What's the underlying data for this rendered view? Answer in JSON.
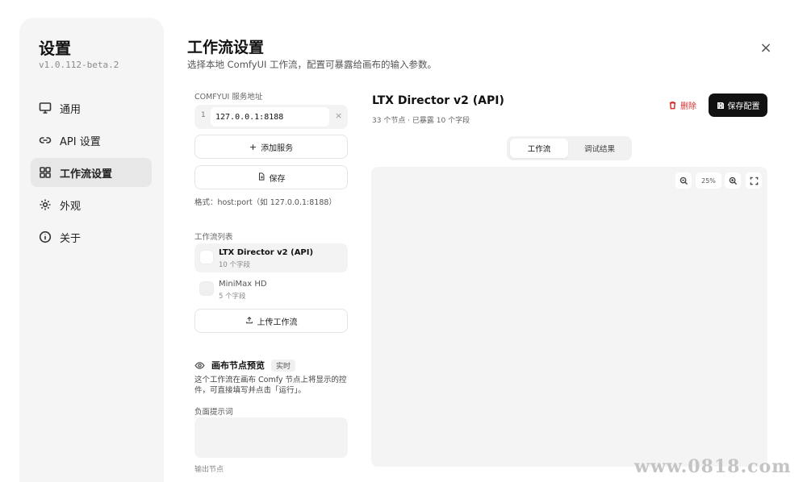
{
  "sidebar": {
    "title": "设置",
    "version": "v1.0.112-beta.2",
    "items": [
      {
        "label": "通用",
        "icon": "monitor-icon"
      },
      {
        "label": "API 设置",
        "icon": "link-icon"
      },
      {
        "label": "工作流设置",
        "icon": "grid-icon",
        "active": true
      },
      {
        "label": "外观",
        "icon": "gear-icon"
      },
      {
        "label": "关于",
        "icon": "info-icon"
      }
    ]
  },
  "header": {
    "title": "工作流设置",
    "description": "选择本地 ComfyUI 工作流，配置可暴露给画布的输入参数。",
    "close_symbol": "×"
  },
  "server": {
    "label": "COMFYUI 服务地址",
    "index": "1",
    "url": "127.0.0.1:8188",
    "remove_symbol": "×",
    "add_label": "添加服务",
    "add_symbol": "+",
    "save_label": "保存",
    "format_hint": "格式：host:port（如 127.0.0.1:8188）"
  },
  "workflow_list": {
    "label": "工作流列表",
    "items": [
      {
        "name": "LTX Director v2 (API)",
        "sub": "10 个字段",
        "active": true
      },
      {
        "name": "MiniMax HD",
        "sub": "5 个字段",
        "active": false
      }
    ],
    "upload_label": "上传工作流"
  },
  "preview": {
    "title": "画布节点预览",
    "badge": "实时",
    "description": "这个工作流在画布 Comfy 节点上将显示的控件，可直接填写并点击「运行」。",
    "prompt_label": "负面提示词",
    "cut_label": "输出节点"
  },
  "detail": {
    "title": "LTX Director v2 (API)",
    "stats": "33 个节点 · 已暴露 10 个字段",
    "delete_label": "删除",
    "save_config_label": "保存配置",
    "tabs": [
      "工作流",
      "调试结果"
    ],
    "zoom_level": "25%"
  },
  "watermark": "www.0818.com",
  "colors": {
    "accent": "#111111",
    "danger": "#d23030",
    "sidebar_bg": "#f5f5f5"
  }
}
